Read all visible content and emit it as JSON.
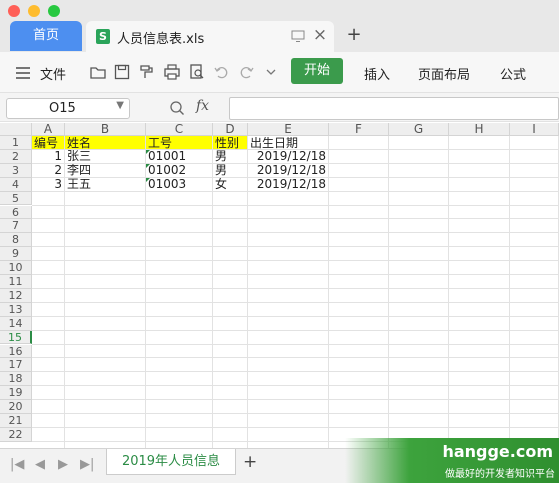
{
  "window": {
    "home_tab": "首页",
    "file_tab": "人员信息表.xls"
  },
  "toolbar": {
    "file_menu": "文件",
    "start": "开始",
    "insert": "插入",
    "page_layout": "页面布局",
    "formula": "公式"
  },
  "formula_bar": {
    "cell_ref": "O15",
    "fx": "fx",
    "value": ""
  },
  "columns": [
    "A",
    "B",
    "C",
    "D",
    "E",
    "F",
    "G",
    "H",
    "I"
  ],
  "rows": [
    "1",
    "2",
    "3",
    "4",
    "5",
    "6",
    "7",
    "8",
    "9",
    "10",
    "11",
    "12",
    "13",
    "14",
    "15",
    "16",
    "17",
    "18",
    "19",
    "20",
    "21",
    "22"
  ],
  "header_row": [
    "编号",
    "姓名",
    "工号",
    "性别",
    "出生日期"
  ],
  "data_rows": [
    [
      "1",
      "张三",
      "01001",
      "男",
      "2019/12/18"
    ],
    [
      "2",
      "李四",
      "01002",
      "男",
      "2019/12/18"
    ],
    [
      "3",
      "王五",
      "01003",
      "女",
      "2019/12/18"
    ]
  ],
  "active_row": "15",
  "sheet": {
    "name": "2019年人员信息"
  },
  "watermark": {
    "site": "hangge.com",
    "tagline": "做最好的开发者知识平台"
  },
  "colors": {
    "accent_green": "#3b9b4c",
    "home_tab_blue": "#4d8ff0",
    "header_yellow": "#ffff00"
  }
}
